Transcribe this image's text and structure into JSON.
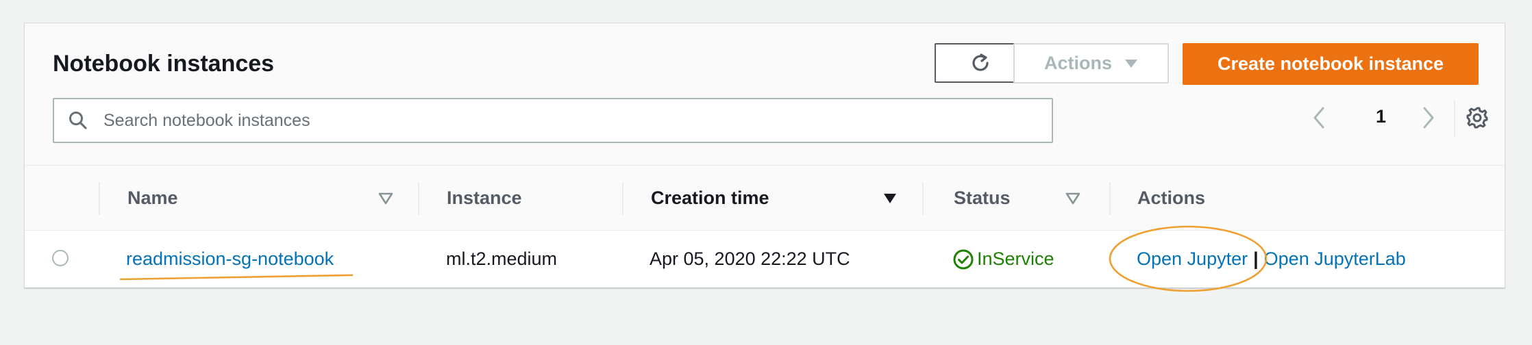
{
  "page": {
    "title": "Notebook instances"
  },
  "toolbar": {
    "refresh_icon": "refresh-icon",
    "actions_label": "Actions",
    "create_label": "Create notebook instance"
  },
  "search": {
    "placeholder": "Search notebook instances",
    "value": ""
  },
  "pagination": {
    "current_page": "1"
  },
  "table": {
    "columns": [
      {
        "label": "Name",
        "sortable": true,
        "sorted": false
      },
      {
        "label": "Instance",
        "sortable": false,
        "sorted": false
      },
      {
        "label": "Creation time",
        "sortable": true,
        "sorted": true
      },
      {
        "label": "Status",
        "sortable": true,
        "sorted": false
      },
      {
        "label": "Actions",
        "sortable": false,
        "sorted": false
      }
    ],
    "rows": [
      {
        "name": "readmission-sg-notebook",
        "instance": "ml.t2.medium",
        "creation_time": "Apr 05, 2020 22:22 UTC",
        "status": "InService",
        "action_open_jupyter": "Open Jupyter",
        "action_separator": "|",
        "action_open_jupyterlab": "Open JupyterLab"
      }
    ]
  },
  "colors": {
    "primary": "#ec7211",
    "link": "#0073bb",
    "success": "#1d8102",
    "annotation": "#f0a030"
  }
}
